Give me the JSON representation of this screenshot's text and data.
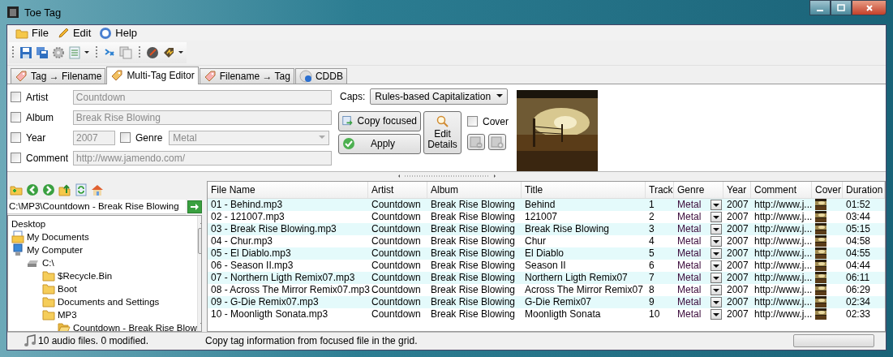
{
  "window": {
    "title": "Toe Tag"
  },
  "menu": [
    {
      "label": "File"
    },
    {
      "label": "Edit"
    },
    {
      "label": "Help"
    }
  ],
  "tabs": [
    {
      "label": "Tag → Filename",
      "selected": false
    },
    {
      "label": "Multi-Tag Editor",
      "selected": true
    },
    {
      "label": "Filename → Tag",
      "selected": false
    },
    {
      "label": "CDDB",
      "selected": false
    }
  ],
  "tag_rows": [
    {
      "fields": [
        {
          "label": "Artist",
          "checked": false,
          "value": "Countdown",
          "disabled": true,
          "kind": "text"
        }
      ]
    },
    {
      "fields": [
        {
          "label": "Album",
          "checked": false,
          "value": "Break Rise Blowing",
          "disabled": true,
          "kind": "text"
        }
      ]
    },
    {
      "fields": [
        {
          "label": "Year",
          "checked": false,
          "value": "2007",
          "disabled": true,
          "kind": "short"
        },
        {
          "label": "Genre",
          "checked": false,
          "value": "Metal",
          "disabled": true,
          "kind": "combo"
        }
      ]
    },
    {
      "fields": [
        {
          "label": "Comment",
          "checked": false,
          "value": "http://www.jamendo.com/",
          "disabled": true,
          "kind": "text"
        }
      ]
    }
  ],
  "caps": {
    "label": "Caps:",
    "value": "Rules-based Capitalization"
  },
  "copy_button": {
    "label": "Copy focused"
  },
  "apply_button": {
    "label": "Apply"
  },
  "details_button": {
    "label": "Edit Details"
  },
  "cover_option": {
    "label": "Cover",
    "checked": false
  },
  "browser": {
    "path": "C:\\MP3\\Countdown - Break Rise Blowing",
    "tree": [
      {
        "label": "Desktop",
        "children": [
          {
            "label": "My Documents",
            "kind": "documents"
          },
          {
            "label": "My Computer",
            "kind": "computer",
            "children": [
              {
                "label": "C:\\",
                "kind": "drive",
                "children": [
                  {
                    "label": "$Recycle.Bin",
                    "kind": "folder"
                  },
                  {
                    "label": "Boot",
                    "kind": "folder"
                  },
                  {
                    "label": "Documents and Settings",
                    "kind": "folder"
                  },
                  {
                    "label": "MP3",
                    "kind": "folder",
                    "children": [
                      {
                        "label": "Countdown - Break Rise Blow",
                        "kind": "open-folder"
                      }
                    ]
                  }
                ]
              }
            ]
          }
        ]
      }
    ]
  },
  "table": {
    "columns": [
      "File Name",
      "Artist",
      "Album",
      "Title",
      "Track",
      "Genre",
      "Year",
      "Comment",
      "Cover",
      "Duration"
    ],
    "rows": [
      {
        "file": "01 - Behind.mp3",
        "artist": "Countdown",
        "album": "Break Rise Blowing",
        "title": "Behind",
        "track": "1",
        "genre": "Metal",
        "year": "2007",
        "comment": "http://www.j...",
        "duration": "01:52"
      },
      {
        "file": "02 - 121007.mp3",
        "artist": "Countdown",
        "album": "Break Rise Blowing",
        "title": "121007",
        "track": "2",
        "genre": "Metal",
        "year": "2007",
        "comment": "http://www.j...",
        "duration": "03:44"
      },
      {
        "file": "03 - Break Rise Blowing.mp3",
        "artist": "Countdown",
        "album": "Break Rise Blowing",
        "title": "Break Rise Blowing",
        "track": "3",
        "genre": "Metal",
        "year": "2007",
        "comment": "http://www.j...",
        "duration": "05:15"
      },
      {
        "file": "04 - Chur.mp3",
        "artist": "Countdown",
        "album": "Break Rise Blowing",
        "title": "Chur",
        "track": "4",
        "genre": "Metal",
        "year": "2007",
        "comment": "http://www.j...",
        "duration": "04:58"
      },
      {
        "file": "05 - El Diablo.mp3",
        "artist": "Countdown",
        "album": "Break Rise Blowing",
        "title": "El Diablo",
        "track": "5",
        "genre": "Metal",
        "year": "2007",
        "comment": "http://www.j...",
        "duration": "04:55"
      },
      {
        "file": "06 - Season II.mp3",
        "artist": "Countdown",
        "album": "Break Rise Blowing",
        "title": "Season II",
        "track": "6",
        "genre": "Metal",
        "year": "2007",
        "comment": "http://www.j...",
        "duration": "04:44"
      },
      {
        "file": "07 - Northern Ligth Remix07.mp3",
        "artist": "Countdown",
        "album": "Break Rise Blowing",
        "title": "Northern Ligth Remix07",
        "track": "7",
        "genre": "Metal",
        "year": "2007",
        "comment": "http://www.j...",
        "duration": "06:11"
      },
      {
        "file": "08 - Across The Mirror Remix07.mp3",
        "artist": "Countdown",
        "album": "Break Rise Blowing",
        "title": "Across The Mirror Remix07",
        "track": "8",
        "genre": "Metal",
        "year": "2007",
        "comment": "http://www.j...",
        "duration": "06:29"
      },
      {
        "file": "09 - G-Die Remix07.mp3",
        "artist": "Countdown",
        "album": "Break Rise Blowing",
        "title": "G-Die Remix07",
        "track": "9",
        "genre": "Metal",
        "year": "2007",
        "comment": "http://www.j...",
        "duration": "02:34"
      },
      {
        "file": "10 - Moonligth Sonata.mp3",
        "artist": "Countdown",
        "album": "Break Rise Blowing",
        "title": "Moonligth Sonata",
        "track": "10",
        "genre": "Metal",
        "year": "2007",
        "comment": "http://www.j...",
        "duration": "02:33"
      }
    ]
  },
  "status_bar": {
    "summary": "10 audio files. 0 modified.",
    "message": "Copy tag information from focused file in the grid.",
    "progress": {
      "level": 0
    }
  }
}
